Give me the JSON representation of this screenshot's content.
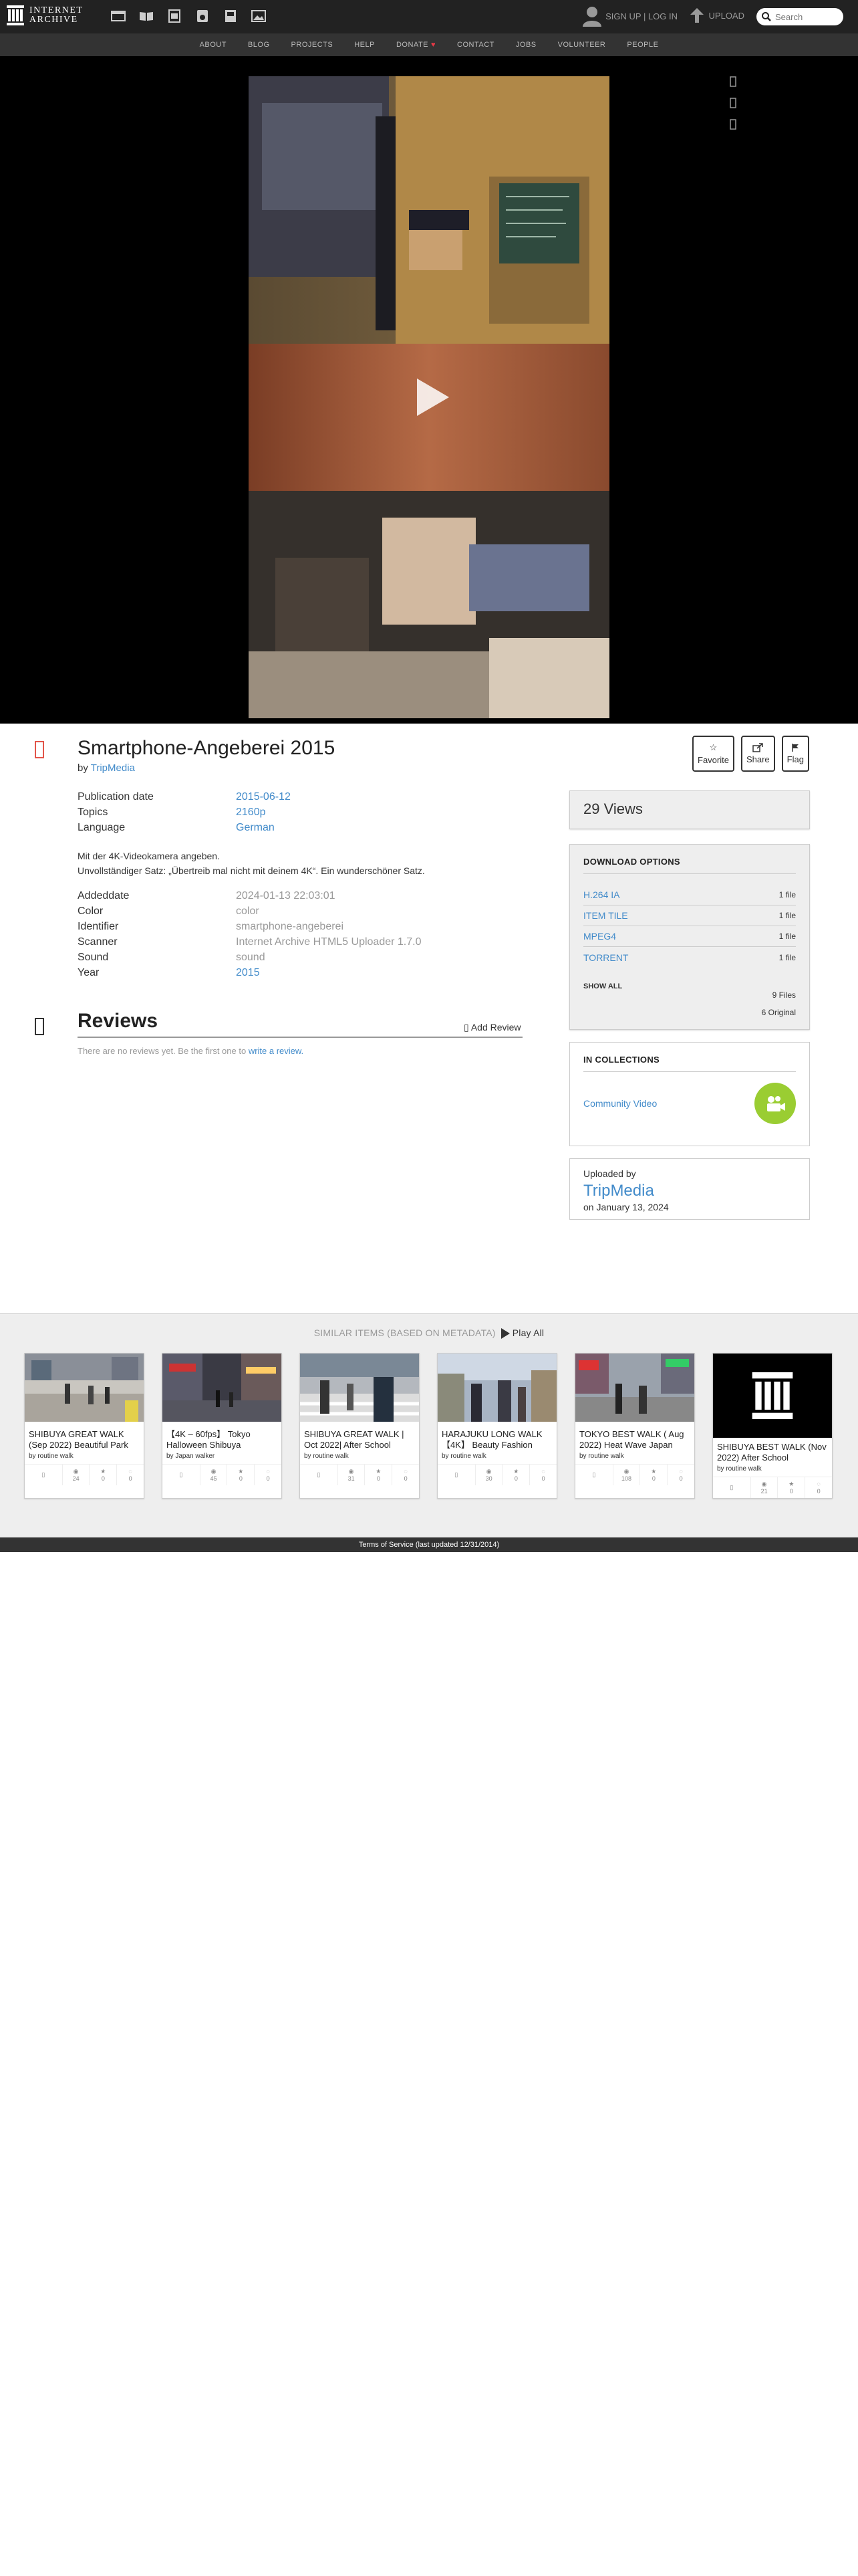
{
  "header": {
    "logo_line1": "INTERNET",
    "logo_line2": "ARCHIVE",
    "signup": "SIGN UP | LOG IN",
    "upload": "UPLOAD",
    "search_placeholder": "Search",
    "media_icons": [
      "web-icon",
      "texts-icon",
      "video-icon",
      "audio-icon",
      "software-icon",
      "images-icon"
    ]
  },
  "nav": {
    "items": [
      "ABOUT",
      "BLOG",
      "PROJECTS",
      "HELP",
      "DONATE",
      "CONTACT",
      "JOBS",
      "VOLUNTEER",
      "PEOPLE"
    ]
  },
  "item": {
    "title": "Smartphone-Angeberei 2015",
    "by_label": "by",
    "creator": "TripMedia",
    "actions": {
      "favorite": "Favorite",
      "share": "Share",
      "flag": "Flag"
    },
    "metadata_top": [
      {
        "key": "Publication date",
        "value": "2015-06-12",
        "link": true
      },
      {
        "key": "Topics",
        "value": "2160p",
        "link": true
      },
      {
        "key": "Language",
        "value": "German",
        "link": true
      }
    ],
    "description_line1": "Mit der 4K-Videokamera angeben.",
    "description_line2": "Unvollständiger Satz: „Übertreib mal nicht mit deinem 4K“. Ein wunderschöner Satz.",
    "metadata_bottom": [
      {
        "key": "Addeddate",
        "value": "2024-01-13 22:03:01",
        "link": false
      },
      {
        "key": "Color",
        "value": "color",
        "link": false
      },
      {
        "key": "Identifier",
        "value": "smartphone-angeberei",
        "link": false
      },
      {
        "key": "Scanner",
        "value": "Internet Archive HTML5 Uploader 1.7.0",
        "link": false
      },
      {
        "key": "Sound",
        "value": "sound",
        "link": false
      },
      {
        "key": "Year",
        "value": "2015",
        "link": true
      }
    ]
  },
  "reviews": {
    "title": "Reviews",
    "add_label": "Add Review",
    "empty_text": "There are no reviews yet. Be the first one to",
    "empty_link": "write a review."
  },
  "sidebar": {
    "views_count": "29",
    "views_label": "Views",
    "download_head": "DOWNLOAD OPTIONS",
    "downloads": [
      {
        "format": "H.264 IA",
        "count": "1 file"
      },
      {
        "format": "ITEM TILE",
        "count": "1 file"
      },
      {
        "format": "MPEG4",
        "count": "1 file"
      },
      {
        "format": "TORRENT",
        "count": "1 file"
      }
    ],
    "show_all": "SHOW ALL",
    "files_total": "9 Files",
    "original_total": "6 Original",
    "collections_head": "IN COLLECTIONS",
    "collection_name": "Community Video",
    "uploaded_by_label": "Uploaded by",
    "uploader": "TripMedia",
    "upload_date": "on January 13, 2024"
  },
  "similar": {
    "head": "SIMILAR ITEMS (based on metadata)",
    "play_all": "Play All",
    "cards": [
      {
        "title": "SHIBUYA GREAT WALK (Sep 2022) Beautiful Park",
        "by": "by routine walk",
        "views": "24",
        "favs": "0",
        "reviews": "0"
      },
      {
        "title": "【4K – 60fps】 Tokyo Halloween Shibuya",
        "by": "by Japan walker",
        "views": "45",
        "favs": "0",
        "reviews": "0"
      },
      {
        "title": "SHIBUYA GREAT WALK | Oct 2022| After School",
        "by": "by routine walk",
        "views": "31",
        "favs": "0",
        "reviews": "0"
      },
      {
        "title": "HARAJUKU LONG WALK 【4K】 Beauty Fashion",
        "by": "by routine walk",
        "views": "30",
        "favs": "0",
        "reviews": "0"
      },
      {
        "title": "TOKYO BEST WALK ( Aug 2022) Heat Wave Japan",
        "by": "by routine walk",
        "views": "108",
        "favs": "0",
        "reviews": "0"
      },
      {
        "title": "SHIBUYA BEST WALK (Nov 2022) After School",
        "by": "by routine walk",
        "views": "21",
        "favs": "0",
        "reviews": "0"
      }
    ]
  },
  "footer": {
    "text": "Terms of Service (last updated 12/31/2014)"
  },
  "colors": {
    "accent": "#428bca",
    "topbar": "#222222",
    "subnav": "#333333",
    "donate_heart": "#e63946",
    "collection_badge": "#9acd32"
  }
}
